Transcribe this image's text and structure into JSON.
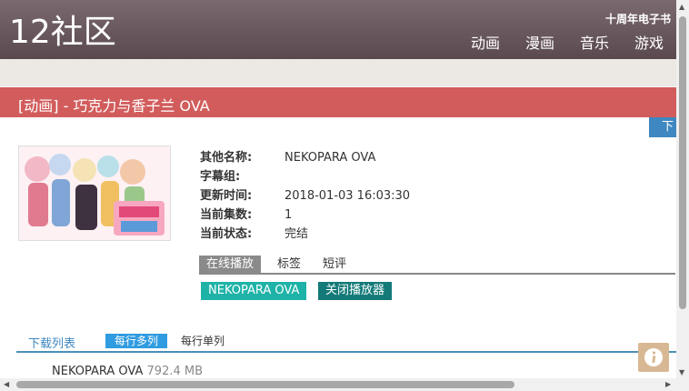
{
  "header": {
    "logo": "12社区",
    "top_link": "十周年电子书",
    "nav": [
      "动画",
      "漫画",
      "音乐",
      "游戏"
    ]
  },
  "page": {
    "title": "[动画] - 巧克力与香子兰 OVA",
    "download_tab": "下"
  },
  "info": {
    "rows": [
      {
        "label": "其他名称:",
        "value": "NEKOPARA OVA"
      },
      {
        "label": "字幕组:",
        "value": ""
      },
      {
        "label": "更新时间:",
        "value": "2018-01-03 16:03:30"
      },
      {
        "label": "当前集数:",
        "value": "1"
      },
      {
        "label": "当前状态:",
        "value": "完结"
      }
    ]
  },
  "tabs": [
    "在线播放",
    "标签",
    "短评"
  ],
  "player": {
    "episode_button": "NEKOPARA OVA",
    "close_button": "关闭播放器"
  },
  "download": {
    "title": "下载列表",
    "options": [
      "每行多列",
      "每行单列"
    ],
    "files": [
      {
        "name": "NEKOPARA OVA",
        "size": "792.4 MB"
      }
    ]
  },
  "colors": {
    "header": "#6a5a60",
    "title_bar": "#d25c5c",
    "accent_blue": "#3f87c0",
    "teal": "#1fb3a8",
    "dark_teal": "#137a78"
  }
}
